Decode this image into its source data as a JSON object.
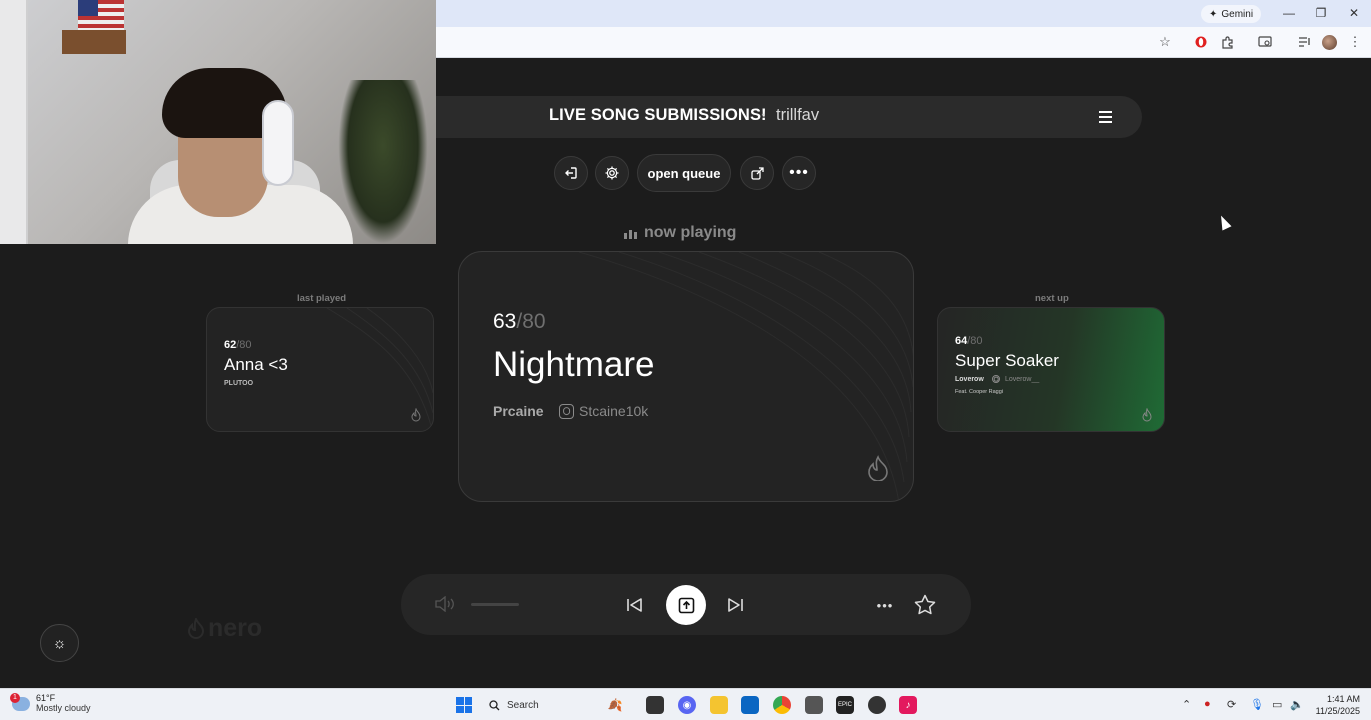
{
  "browser": {
    "gemini_label": "Gemini",
    "window_controls": [
      "minimize",
      "restore",
      "close"
    ],
    "toolbar_icons": [
      "star-icon",
      "opera-icon",
      "extensions-icon",
      "cast-icon",
      "media-icon",
      "profile-avatar",
      "more-icon"
    ]
  },
  "app": {
    "header": {
      "title": "LIVE SONG SUBMISSIONS!",
      "separator": "·",
      "username": "trillfav"
    },
    "controls": {
      "open_queue_label": "open queue",
      "icons": [
        "leave-icon",
        "settings-icon",
        "open-queue",
        "share-icon",
        "more-icon"
      ]
    },
    "now_playing_label": "now playing",
    "last_played": {
      "section_label": "last played",
      "position": "62",
      "total": "/80",
      "title": "Anna <3",
      "artist": "PLUTOO"
    },
    "current": {
      "position": "63",
      "total": "/80",
      "title": "Nightmare",
      "artist": "Prcaine",
      "instagram": "Stcaine10k"
    },
    "next_up": {
      "section_label": "next up",
      "position": "64",
      "total": "/80",
      "title": "Super Soaker",
      "artist": "Loverow",
      "instagram": "Loverow__",
      "feature": "Feat. Cooper Raggi"
    },
    "watermark": "nero",
    "colors": {
      "background": "#1c1c1c",
      "card": "#232323",
      "accent_green": "#1f6b35"
    }
  },
  "taskbar": {
    "weather": {
      "badge": "1",
      "temp": "61°F",
      "condition": "Mostly cloudy"
    },
    "search_placeholder": "Search",
    "clock": {
      "time": "1:41 AM",
      "date": "11/25/2025"
    }
  }
}
